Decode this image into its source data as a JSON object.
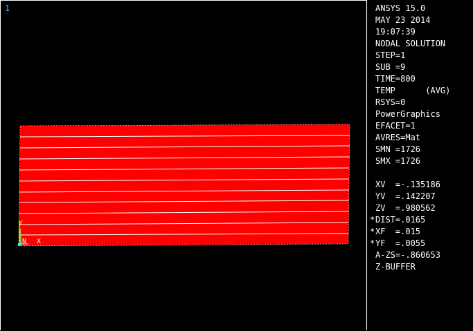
{
  "window": {
    "number": "1"
  },
  "info": {
    "program": "ANSYS 15.0",
    "date": "MAY 23 2014",
    "time": "19:07:39",
    "solution": "NODAL SOLUTION",
    "step": "STEP=1",
    "sub": "SUB =9",
    "time_value": "TIME=800",
    "item": "TEMP      (AVG)",
    "rsys": "RSYS=0",
    "graphics": "PowerGraphics",
    "efacet": "EFACET=1",
    "avres": "AVRES=Mat",
    "smn": "SMN =1726",
    "smx": "SMX =1726",
    "xv": "XV  =-.135186",
    "yv": "YV  =.142207",
    "zv": "ZV  =.980562",
    "dist": "DIST=.0165",
    "xf": "XF  =.015",
    "yf": "YF  =.0055",
    "azs": "A-ZS=-.860653",
    "zbuffer": "Z-BUFFER",
    "changed_marker": "*"
  },
  "triad": {
    "y_label": "Y",
    "n_label": "N",
    "x_label": "X"
  },
  "colors": {
    "background": "#000000",
    "contour_fill": "#ff0000",
    "element_edges": "#ffffff",
    "window_number": "#3ab8ff",
    "triad_x": "#ffffff",
    "triad_y": "#ffff00",
    "triad_z": "#00ffff"
  }
}
